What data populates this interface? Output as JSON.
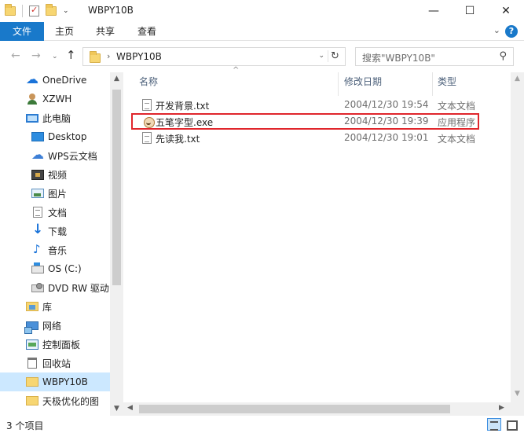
{
  "window": {
    "title": "WBPY10B",
    "minimize": "—",
    "maximize": "☐",
    "close": "✕"
  },
  "ribbon": {
    "tabs": [
      "文件",
      "主页",
      "共享",
      "查看"
    ],
    "expand_glyph": "⌄",
    "help_glyph": "?"
  },
  "nav": {
    "back": "←",
    "forward": "→",
    "recent": "⌄",
    "up": "↑",
    "address_separator": "›",
    "address": "WBPY10B",
    "address_dropdown": "⌄",
    "refresh": "↻",
    "search_placeholder": "搜索\"WBPY10B\"",
    "search_glyph": "⚲"
  },
  "sidebar": {
    "expand_glyph": "›",
    "items": [
      {
        "label": "OneDrive",
        "icon": "onedrive-icon"
      },
      {
        "label": "XZWH",
        "icon": "user-icon"
      },
      {
        "label": "此电脑",
        "icon": "this-pc-icon"
      },
      {
        "label": "Desktop",
        "icon": "desktop-icon"
      },
      {
        "label": "WPS云文档",
        "icon": "wps-cloud-icon"
      },
      {
        "label": "视频",
        "icon": "video-folder-icon"
      },
      {
        "label": "图片",
        "icon": "pictures-folder-icon"
      },
      {
        "label": "文档",
        "icon": "documents-folder-icon"
      },
      {
        "label": "下载",
        "icon": "downloads-folder-icon"
      },
      {
        "label": "音乐",
        "icon": "music-folder-icon"
      },
      {
        "label": "OS (C:)",
        "icon": "drive-c-icon"
      },
      {
        "label": "DVD RW 驱动",
        "icon": "dvd-drive-icon"
      },
      {
        "label": "库",
        "icon": "libraries-icon"
      },
      {
        "label": "网络",
        "icon": "network-icon"
      },
      {
        "label": "控制面板",
        "icon": "control-panel-icon"
      },
      {
        "label": "回收站",
        "icon": "recycle-bin-icon"
      },
      {
        "label": "WBPY10B",
        "icon": "folder-icon",
        "selected": true
      },
      {
        "label": "天极优化的图",
        "icon": "folder-icon"
      }
    ]
  },
  "columns": {
    "name": "名称",
    "date": "修改日期",
    "type": "类型",
    "sort_glyph": "^"
  },
  "files": [
    {
      "name": "开发背景.txt",
      "date": "2004/12/30 19:54",
      "type": "文本文档",
      "icon": "text-file-icon"
    },
    {
      "name": "五笔字型.exe",
      "date": "2004/12/30 19:39",
      "type": "应用程序",
      "icon": "exe-file-icon",
      "highlighted": true
    },
    {
      "name": "先读我.txt",
      "date": "2004/12/30 19:01",
      "type": "文本文档",
      "icon": "text-file-icon"
    }
  ],
  "scrollbars": {
    "up": "▲",
    "down": "▼",
    "left": "◀",
    "right": "▶"
  },
  "status": {
    "item_count": "3 个项目"
  },
  "colors": {
    "accent": "#1979ca",
    "selection": "#cce8ff",
    "highlight_border": "#e0262c"
  }
}
